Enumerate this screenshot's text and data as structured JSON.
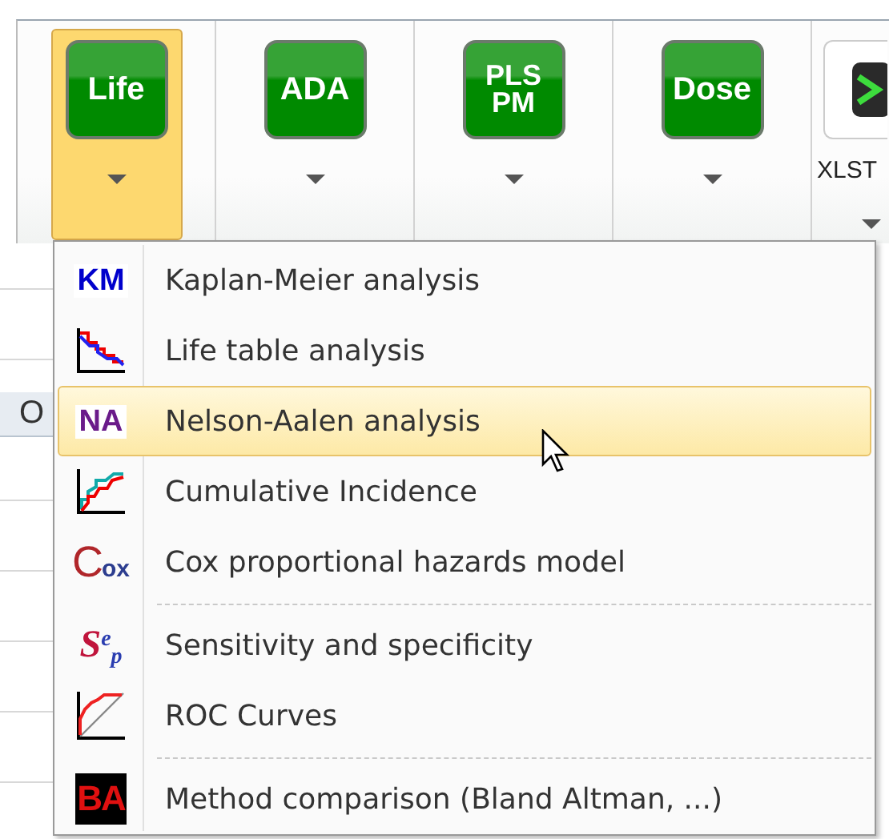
{
  "ribbon": {
    "buttons": [
      {
        "kind": "green",
        "label": "Life",
        "selected": true
      },
      {
        "kind": "green",
        "label": "ADA",
        "selected": false
      },
      {
        "kind": "green",
        "label": "PLS PM",
        "selected": false
      },
      {
        "kind": "green",
        "label": "Dose",
        "selected": false
      },
      {
        "kind": "dark",
        "label": "XLST",
        "selected": false
      }
    ]
  },
  "sheet": {
    "column_header": "O"
  },
  "menu": {
    "items": [
      {
        "kind": "item",
        "icon": {
          "kind": "letters",
          "text": "KM",
          "color": "#0000cc"
        },
        "label": "Kaplan-Meier analysis",
        "selected": false
      },
      {
        "kind": "item",
        "icon": {
          "kind": "step-down"
        },
        "label": "Life table analysis",
        "selected": false
      },
      {
        "kind": "item",
        "icon": {
          "kind": "letters",
          "text": "NA",
          "color": "#6a1b8a"
        },
        "label": "Nelson-Aalen analysis",
        "selected": true
      },
      {
        "kind": "item",
        "icon": {
          "kind": "step-up"
        },
        "label": "Cumulative Incidence",
        "selected": false
      },
      {
        "kind": "item",
        "icon": {
          "kind": "cox",
          "big": "C",
          "small": "ox"
        },
        "label": "Cox proportional hazards model",
        "selected": false
      },
      {
        "kind": "separator"
      },
      {
        "kind": "item",
        "icon": {
          "kind": "script",
          "text": "S$^{e}$$_{p}$"
        },
        "label": "Sensitivity and specificity",
        "selected": false
      },
      {
        "kind": "item",
        "icon": {
          "kind": "roc"
        },
        "label": "ROC Curves",
        "selected": false
      },
      {
        "kind": "separator"
      },
      {
        "kind": "item",
        "icon": {
          "kind": "block",
          "text": "BA"
        },
        "label": "Method comparison (Bland Altman, ...)",
        "selected": false
      }
    ]
  }
}
